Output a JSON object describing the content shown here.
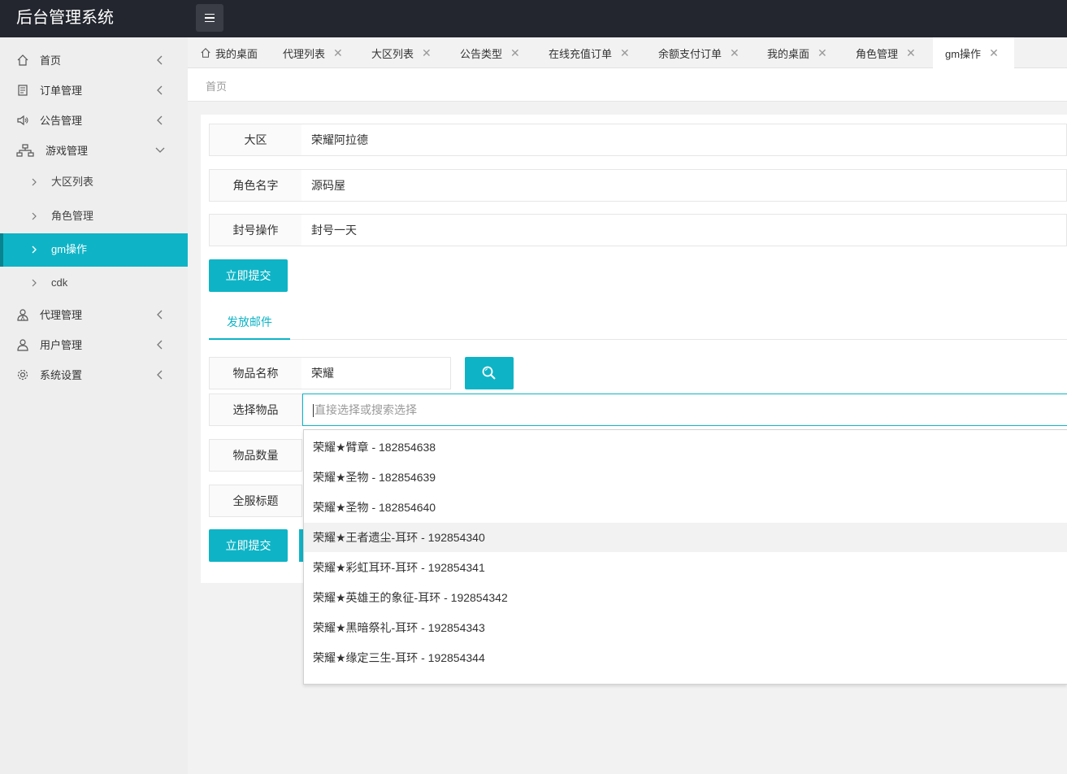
{
  "app": {
    "title": "后台管理系统"
  },
  "sidebar": {
    "items": [
      {
        "label": "首页",
        "icon": "home-icon"
      },
      {
        "label": "订单管理",
        "icon": "document-icon"
      },
      {
        "label": "公告管理",
        "icon": "speaker-icon"
      },
      {
        "label": "游戏管理",
        "icon": "sitemap-icon"
      },
      {
        "label": "代理管理",
        "icon": "users-icon"
      },
      {
        "label": "用户管理",
        "icon": "user-icon"
      },
      {
        "label": "系统设置",
        "icon": "gear-icon"
      }
    ],
    "subitems": [
      {
        "label": "大区列表"
      },
      {
        "label": "角色管理"
      },
      {
        "label": "gm操作"
      },
      {
        "label": "cdk"
      }
    ]
  },
  "tabs": [
    {
      "label": "我的桌面"
    },
    {
      "label": "代理列表"
    },
    {
      "label": "大区列表"
    },
    {
      "label": "公告类型"
    },
    {
      "label": "在线充值订单"
    },
    {
      "label": "余额支付订单"
    },
    {
      "label": "我的桌面"
    },
    {
      "label": "角色管理"
    },
    {
      "label": "gm操作"
    }
  ],
  "breadcrumb": "首页",
  "form": {
    "region_label": "大区",
    "region_value": "荣耀阿拉德",
    "role_label": "角色名字",
    "role_value": "源码屋",
    "ban_label": "封号操作",
    "ban_value": "封号一天",
    "submit_label": "立即提交"
  },
  "mail": {
    "tab_label": "发放邮件",
    "item_name_label": "物品名称",
    "item_name_value": "荣耀",
    "select_label": "选择物品",
    "select_placeholder": "直接选择或搜索选择",
    "quantity_label": "物品数量",
    "title_label": "全服标题",
    "submit_label": "立即提交",
    "options": [
      "荣耀★臂章 - 182854638",
      "荣耀★圣物 - 182854639",
      "荣耀★圣物 - 182854640",
      "荣耀★王者遗尘-耳环 - 192854340",
      "荣耀★彩虹耳环-耳环 - 192854341",
      "荣耀★英雄王的象征-耳环 - 192854342",
      "荣耀★黑暗祭礼-耳环 - 192854343",
      "荣耀★缘定三生-耳环 - 192854344"
    ]
  },
  "colors": {
    "accent": "#0eb4c6",
    "header": "#23262e"
  }
}
